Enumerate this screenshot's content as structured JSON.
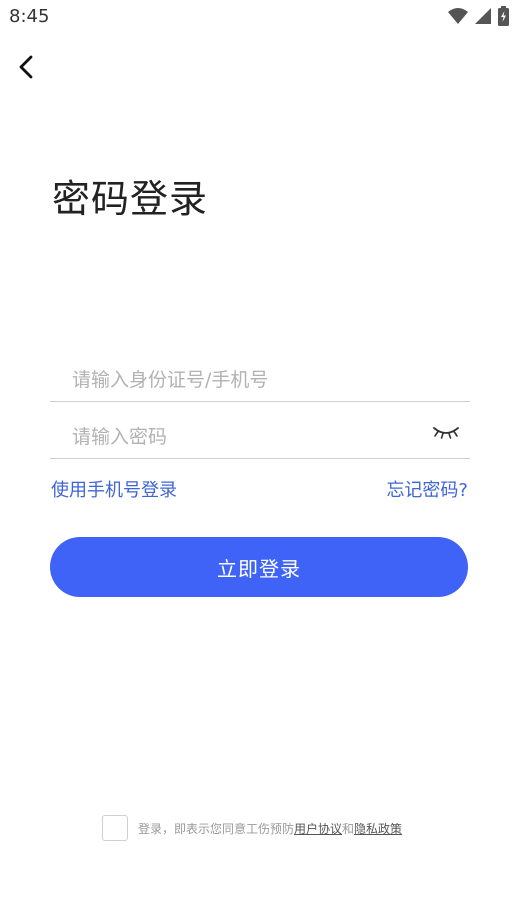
{
  "status_bar": {
    "time": "8:45"
  },
  "page": {
    "title": "密码登录"
  },
  "form": {
    "account_placeholder": "请输入身份证号/手机号",
    "password_placeholder": "请输入密码",
    "phone_login_link": "使用手机号登录",
    "forgot_password_link": "忘记密码?",
    "login_button": "立即登录"
  },
  "agreement": {
    "prefix": "登录，即表示您同意工伤预防",
    "user_agreement": "用户协议",
    "and": "和",
    "privacy_policy": "隐私政策"
  },
  "colors": {
    "primary": "#3f63f6",
    "link": "#3f64d6"
  }
}
